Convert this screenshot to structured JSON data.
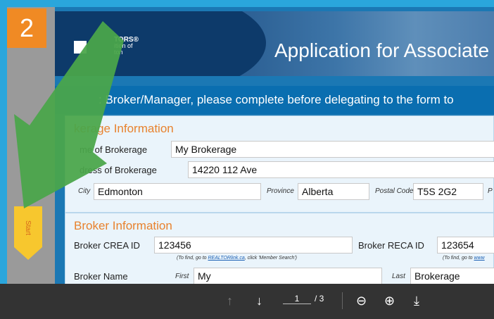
{
  "step": {
    "number": "2"
  },
  "start_tab": {
    "label": "Start",
    "color": "#f7c72e"
  },
  "header": {
    "logo_line1": "TORS®",
    "logo_line2": "ition of",
    "logo_line3": "ton",
    "title": "Application for Associate"
  },
  "instruction": {
    "text": ": Broker/Manager, please complete before delegating to the form to"
  },
  "brokerage": {
    "section_title": "kerage Information",
    "name_label": "me of Brokerage",
    "name_value": "My Brokerage",
    "address_label": "dress of Brokerage",
    "address_value": "14220 112 Ave",
    "city_label": "City",
    "city_value": "Edmonton",
    "province_label": "Province",
    "province_value": "Alberta",
    "postal_label": "Postal Code",
    "postal_value": "T5S 2G2",
    "phone_label": "P"
  },
  "broker": {
    "section_title": "Broker Information",
    "crea_label": "Broker CREA ID",
    "crea_value": "123456",
    "crea_hint_prefix": "(To find, go to ",
    "crea_hint_link": "REALTORlink.ca",
    "crea_hint_suffix": ", click 'Member Search')",
    "reca_label": "Broker RECA ID",
    "reca_value": "123654",
    "reca_hint_prefix": "(To find, go to ",
    "reca_hint_link": "www",
    "name_label": "Broker Name",
    "first_label": "First",
    "first_value": "My",
    "last_label": "Last",
    "last_value": "Brokerage"
  },
  "toolbar": {
    "prev_icon": "↑",
    "next_icon": "↓",
    "page_current": "1",
    "page_total": "/ 3",
    "zoom_out_icon": "⊖",
    "zoom_in_icon": "⊕",
    "download_icon": "⤓"
  },
  "colors": {
    "frame": "#2aa6dc",
    "badge": "#f08a24",
    "arrow": "#4aa64a",
    "section_title": "#e8822e"
  }
}
